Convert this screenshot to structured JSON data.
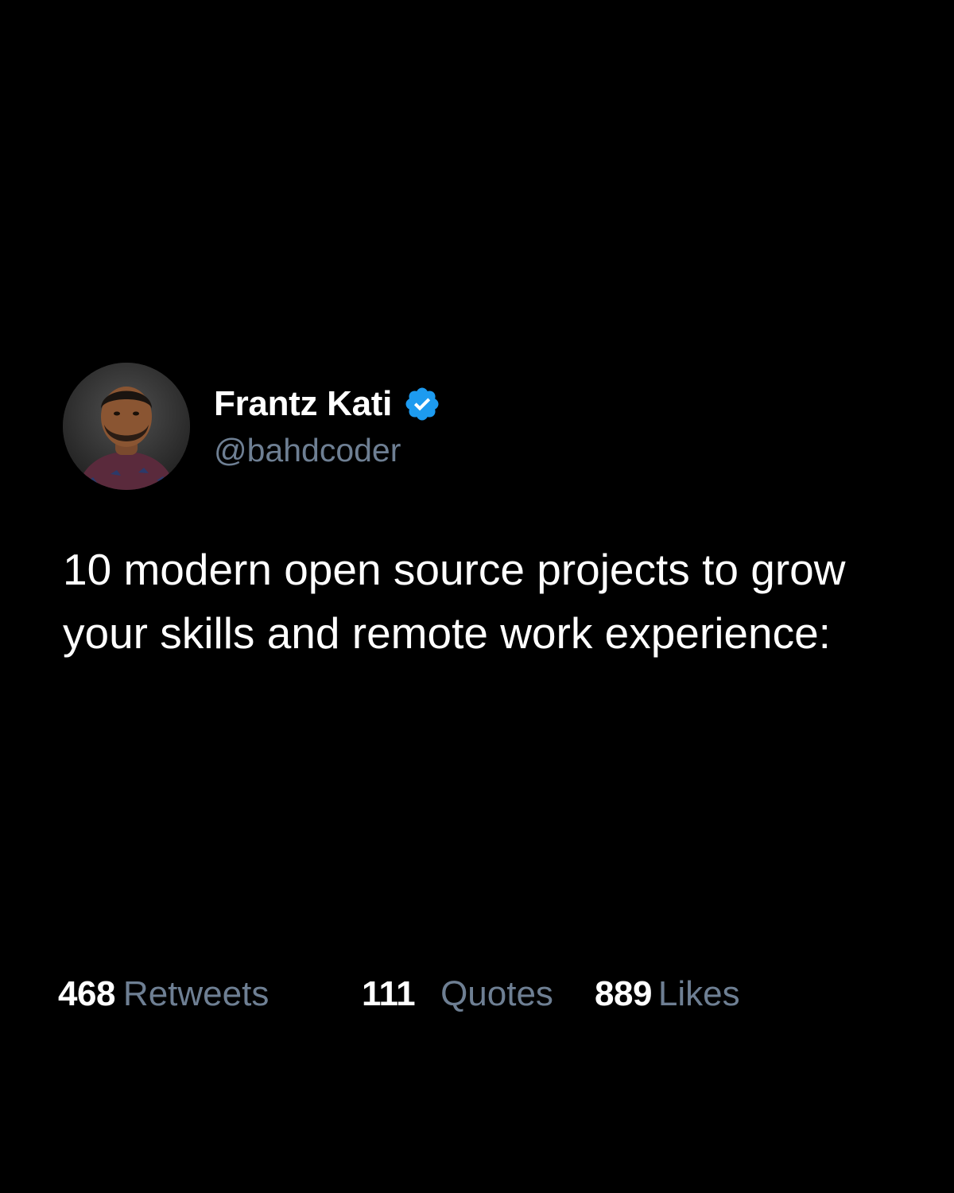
{
  "author": {
    "name": "Frantz Kati",
    "handle": "@bahdcoder",
    "verified": true,
    "verified_badge_color": "#1d9bf0",
    "avatar_icon": "profile-photo"
  },
  "tweet": {
    "text": "10 modern open source projects to grow your skills and remote work experience:"
  },
  "stats": {
    "retweets": {
      "count": "468",
      "label": "Retweets"
    },
    "quotes": {
      "count": "111",
      "label": "Quotes"
    },
    "likes": {
      "count": "889",
      "label": "Likes"
    }
  },
  "colors": {
    "background": "#000000",
    "primary_text": "#ffffff",
    "secondary_text": "#6e7f93"
  }
}
